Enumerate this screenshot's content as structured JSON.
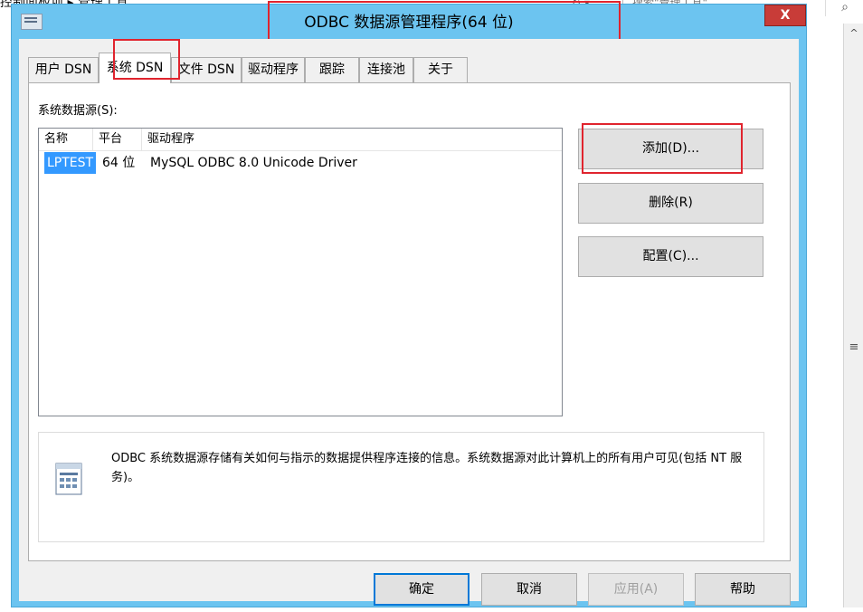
{
  "background": {
    "breadcrumb": "控制面板项 ▸ 管理工具",
    "search_placeholder": "搜索\"管理工具\"",
    "nav_arrows": "↻ ▾",
    "search_icon": "search-icon",
    "scroll_up_glyph": "^",
    "scroll_grip_glyph": "≡"
  },
  "dialog": {
    "title": "ODBC 数据源管理程序(64 位)",
    "close_label": "X",
    "tabs": [
      {
        "label": "用户 DSN",
        "active": false
      },
      {
        "label": "系统 DSN",
        "active": true
      },
      {
        "label": "文件 DSN",
        "active": false
      },
      {
        "label": "驱动程序",
        "active": false
      },
      {
        "label": "跟踪",
        "active": false
      },
      {
        "label": "连接池",
        "active": false
      },
      {
        "label": "关于",
        "active": false
      }
    ],
    "section_label": "系统数据源(S):",
    "columns": [
      "名称",
      "平台",
      "驱动程序"
    ],
    "rows": [
      {
        "name": "LPTEST",
        "platform": "64 位",
        "driver": "MySQL ODBC 8.0 Unicode Driver",
        "selected": true
      }
    ],
    "side_buttons": {
      "add": "添加(D)...",
      "remove": "删除(R)",
      "configure": "配置(C)..."
    },
    "info_text": "ODBC 系统数据源存储有关如何与指示的数据提供程序连接的信息。系统数据源对此计算机上的所有用户可见(包括 NT 服务)。",
    "bottom_buttons": {
      "ok": "确定",
      "cancel": "取消",
      "apply": "应用(A)",
      "help": "帮助"
    }
  },
  "colors": {
    "title_bar": "#6cc4f0",
    "close_button": "#c83c38",
    "highlight_red": "#e0242e",
    "selection": "#3399ff"
  }
}
